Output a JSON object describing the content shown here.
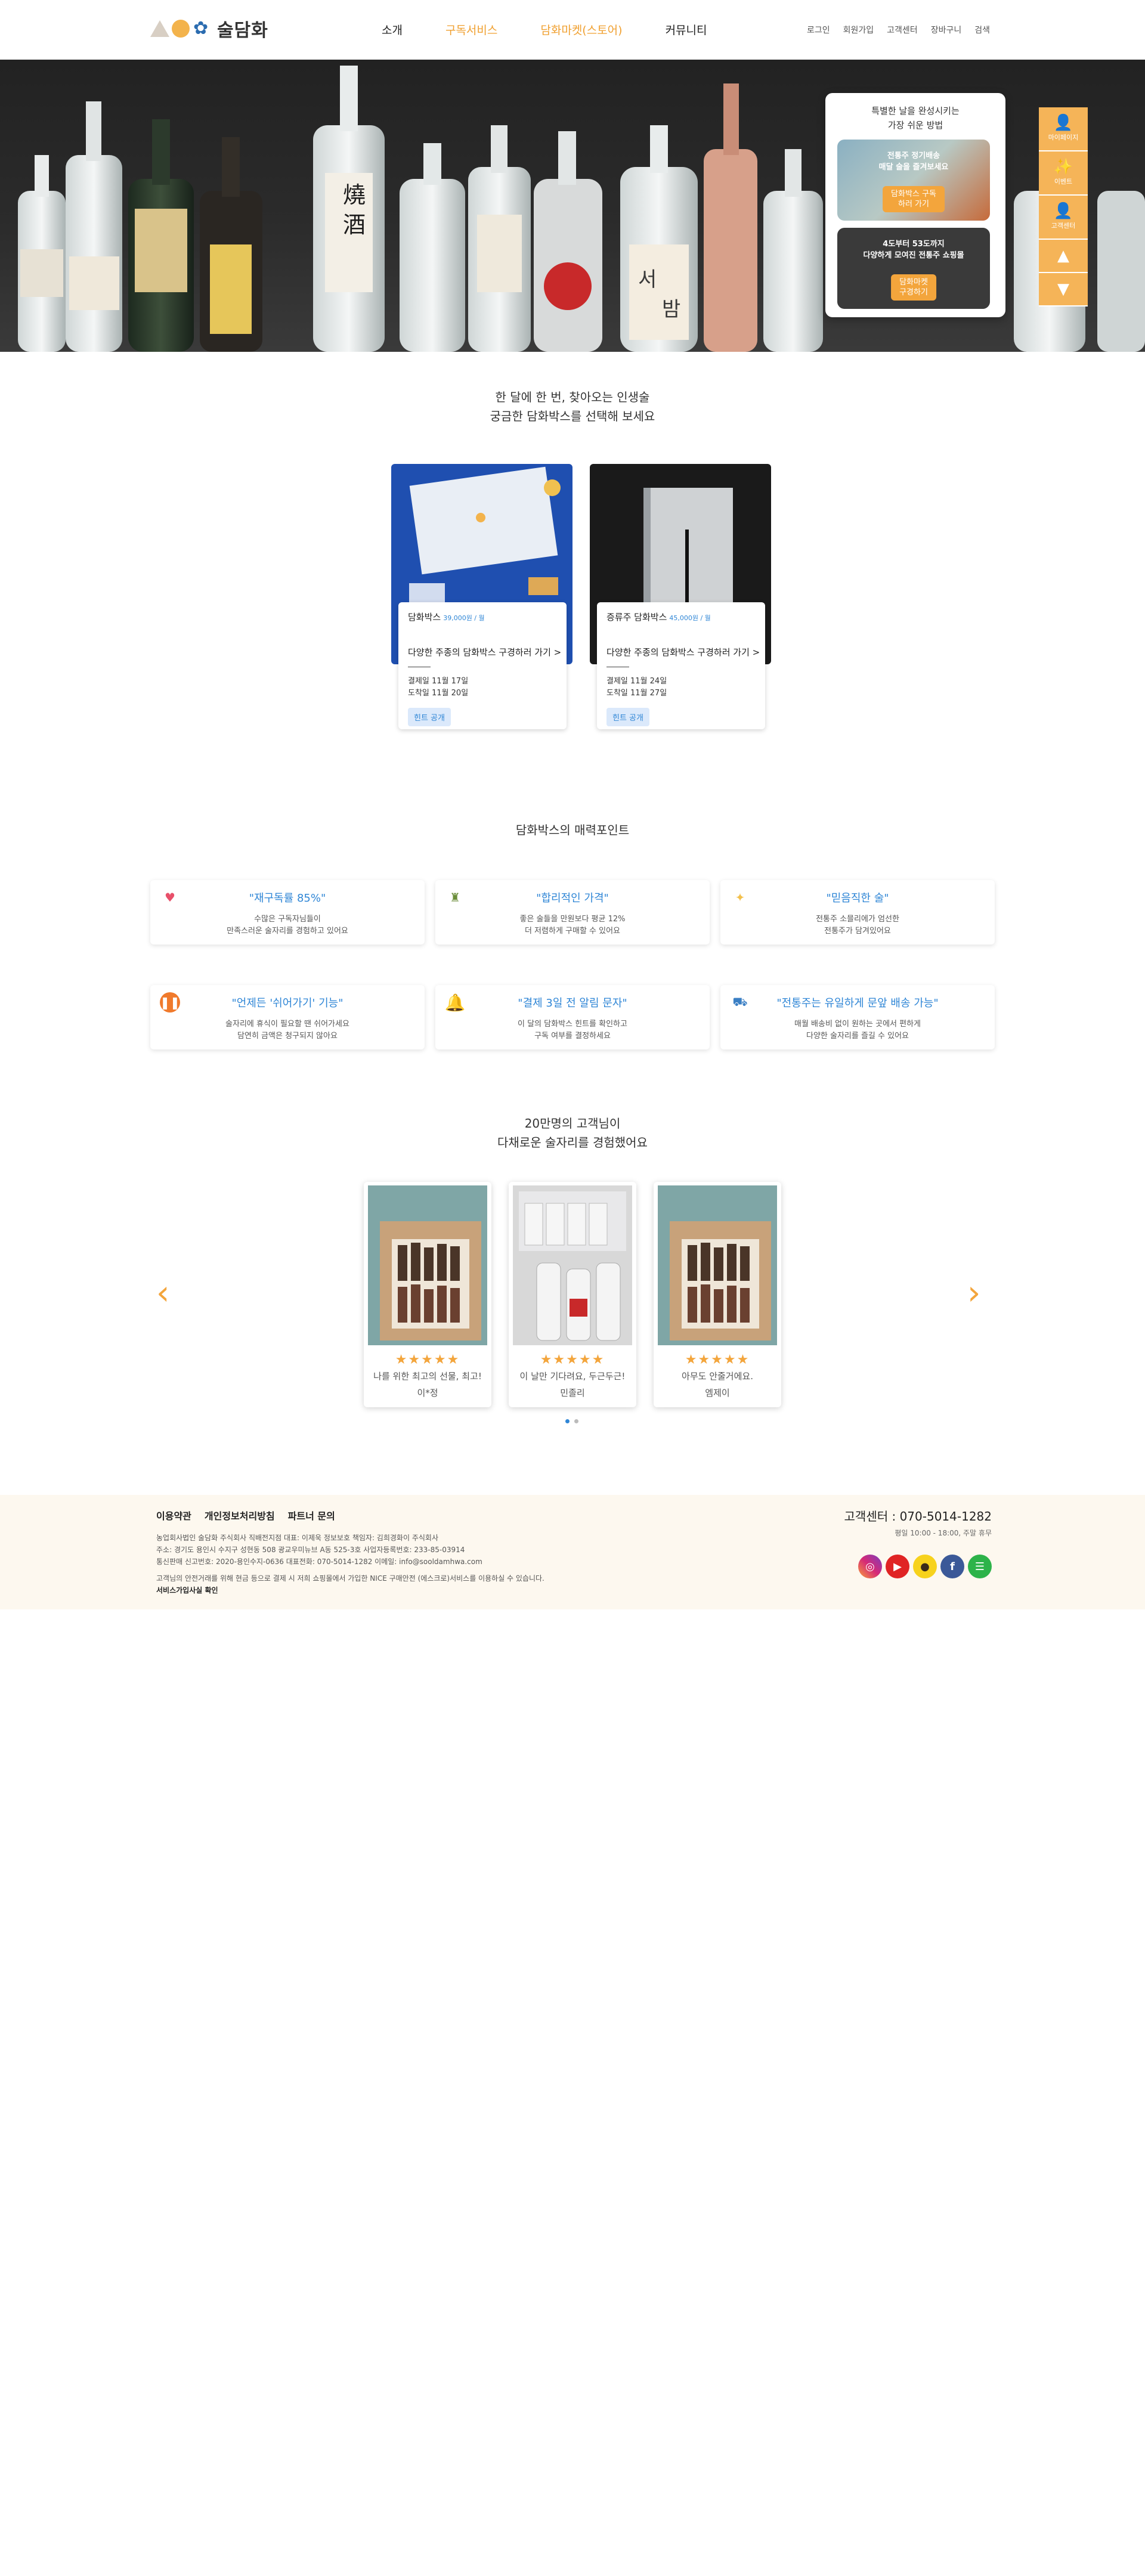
{
  "header": {
    "logo_text": "술담화",
    "nav": [
      "소개",
      "구독서비스",
      "담화마켓(스토어)",
      "커뮤니티"
    ],
    "util": [
      "로그인",
      "회원가입",
      "고객센터",
      "장바구니",
      "검색"
    ]
  },
  "hero": {
    "promo_title_1": "특별한 날을 완성시키는",
    "promo_title_2": "가장 쉬운 방법",
    "card1_text_1": "전통주 정기배송",
    "card1_text_2": "매달 술을 즐겨보세요",
    "card1_btn_1": "담화박스 구독",
    "card1_btn_2": "하러 가기",
    "card2_text_1": "4도부터 53도까지",
    "card2_text_2": "다양하게 모여진 전통주 쇼핑몰",
    "card2_btn_1": "담화마켓",
    "card2_btn_2": "구경하기",
    "quick": [
      "마이페이지",
      "이벤트",
      "고객센터"
    ]
  },
  "intro": {
    "line1": "한 달에 한 번, 찾아오는 인생술",
    "line2": "궁금한 담화박스를 선택해 보세요"
  },
  "products": [
    {
      "name": "담화박스",
      "price": "39,000원 / 월",
      "desc": "다양한 주종의 담화박스 구경하러 가기 >",
      "pay_date": "결제일 11월 17일",
      "arrive_date": "도착일 11월 20일",
      "tag": "힌트 공개"
    },
    {
      "name": "증류주 담화박스",
      "price": "45,000원 / 월",
      "desc": "다양한 주종의 담화박스 구경하러 가기 >",
      "pay_date": "결제일 11월 24일",
      "arrive_date": "도착일 11월 27일",
      "tag": "힌트 공개"
    }
  ],
  "features_title": "담화박스의 매력포인트",
  "features": [
    {
      "title": "\"재구독률 85%\"",
      "desc1": "수많은 구독자님들이",
      "desc2": "만족스러운 술자리를 경험하고 있어요",
      "icon": "heart-icon",
      "color": "#e8506a"
    },
    {
      "title": "\"합리적인 가격\"",
      "desc1": "좋은 술들을 만원보다 평균 12%",
      "desc2": "더 저렴하게 구매할 수 있어요",
      "icon": "bottles-icon",
      "color": "#6b8e3a"
    },
    {
      "title": "\"믿음직한 술\"",
      "desc1": "전통주 소믈리에가 엄선한",
      "desc2": "전통주가 담겨있어요",
      "icon": "sparkle-icon",
      "color": "#f3c04c"
    },
    {
      "title": "\"언제든 '쉬어가기' 기능\"",
      "desc1": "술자리에 휴식이 필요할 땐 쉬어가세요",
      "desc2": "담연히 금액은 청구되지 않아요",
      "icon": "pause-icon",
      "color": "#f07a2c"
    },
    {
      "title": "\"결제 3일 전 알림 문자\"",
      "desc1": "이 달의 담화박스 힌트를 확인하고",
      "desc2": "구독 여부를 결정하세요",
      "icon": "bell-icon",
      "color": "#f3a53c"
    },
    {
      "title": "\"전통주는 유일하게 문앞 배송 가능\"",
      "desc1": "매월 배송비 없이 원하는 곳에서 편하게",
      "desc2": "다양한 술자리를 즐길 수 있어요",
      "icon": "truck-icon",
      "color": "#3b7fc4"
    }
  ],
  "reviews_title_1": "20만명의 고객님이",
  "reviews_title_2": "다채로운 술자리를 경험했어요",
  "reviews": [
    {
      "stars": "★★★★★",
      "text": "나를 위한 최고의 선물, 최고!",
      "author": "이*정"
    },
    {
      "stars": "★★★★★",
      "text": "이 날만 기다려요, 두근두근!",
      "author": "민졸리"
    },
    {
      "stars": "★★★★★",
      "text": "아무도 안줄거에요.",
      "author": "엠제이"
    }
  ],
  "footer": {
    "links": [
      "이용약관",
      "개인정보처리방침",
      "파트너 문의"
    ],
    "info1": "농업회사법인 술담화 주식회사 직배전지점 대표: 이제욱 정보보호 책임자: 김희경화이 주식회사",
    "info2": "주소: 경기도 용인시 수지구 성현동 508 광교우미뉴브 A동 525-3호 사업자등록번호: 233-85-03914",
    "info3": "통신판매 신고번호: 2020-용인수지-0636 대표전화: 070-5014-1282 이메일: info@sooldamhwa.com",
    "info4": "고객님의 안전거래를 위해 현금 등으로 결제 시 저희 쇼핑몰에서 가입한 NICE 구매안전 (에스크로)서비스를 이용하실 수 있습니다.",
    "escrow": "서비스가입사실 확인",
    "tel": "고객센터 : 070-5014-1282",
    "hours": "평일 10:00 - 18:00, 주말 휴무"
  }
}
